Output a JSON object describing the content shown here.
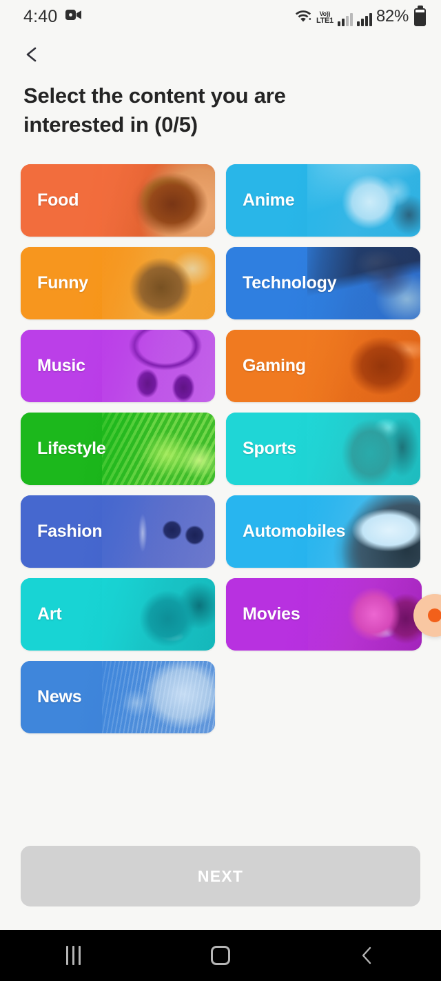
{
  "status_bar": {
    "time": "4:40",
    "recording_icon": "video-camera-icon",
    "wifi_icon": "wifi-icon",
    "volte_line1": "Vo))",
    "volte_line2": "LTE1",
    "signal_icon_1": "signal-bars-icon",
    "signal_icon_2": "signal-bars-icon",
    "battery_percent": "82%",
    "battery_icon": "battery-icon"
  },
  "header": {
    "back_icon": "back-chevron-icon",
    "title": "Select the content you are interested in (0/5)",
    "selected_count": 0,
    "max_count": 5
  },
  "categories": [
    {
      "label": "Food",
      "color_start": "#f26d3d",
      "color_end": "#e8602c",
      "image": "ramen-bowl-photo"
    },
    {
      "label": "Anime",
      "color_start": "#29b6e8",
      "color_end": "#1eaade",
      "image": "anime-girl-photo"
    },
    {
      "label": "Funny",
      "color_start": "#f7961e",
      "color_end": "#f5920f",
      "image": "laughing-man-photo"
    },
    {
      "label": "Technology",
      "color_start": "#2f7fe0",
      "color_end": "#2b6fd4",
      "image": "rocket-launch-photo"
    },
    {
      "label": "Music",
      "color_start": "#bb3fe8",
      "color_end": "#b02fe3",
      "image": "headphones-photo"
    },
    {
      "label": "Gaming",
      "color_start": "#f07a20",
      "color_end": "#ec6c18",
      "image": "mech-robot-photo"
    },
    {
      "label": "Lifestyle",
      "color_start": "#1cb81c",
      "color_end": "#14a814",
      "image": "green-textiles-photo"
    },
    {
      "label": "Sports",
      "color_start": "#1fd6d6",
      "color_end": "#19cbcb",
      "image": "athlete-back-photo"
    },
    {
      "label": "Fashion",
      "color_start": "#4668cf",
      "color_end": "#3f5ec6",
      "image": "sunglasses-photo"
    },
    {
      "label": "Automobiles",
      "color_start": "#28b5ef",
      "color_end": "#1fa9e6",
      "image": "white-car-photo"
    },
    {
      "label": "Art",
      "color_start": "#18d4d4",
      "color_end": "#12c9c9",
      "image": "turquoise-face-photo"
    },
    {
      "label": "Movies",
      "color_start": "#b831e0",
      "color_end": "#ae27d8",
      "image": "iron-man-photo"
    },
    {
      "label": "News",
      "color_start": "#3f86db",
      "color_end": "#3a7ad2",
      "image": "newspaper-photo"
    }
  ],
  "floating_action": {
    "icon": "orange-bubble-icon",
    "color": "#f2601a",
    "halo_color": "#f9c7a2"
  },
  "footer": {
    "next_label": "NEXT",
    "next_enabled": false,
    "next_bg": "#d2d2d2"
  },
  "nav_bar": {
    "recents_icon": "recents-icon",
    "home_icon": "home-icon",
    "back_icon": "back-icon"
  }
}
